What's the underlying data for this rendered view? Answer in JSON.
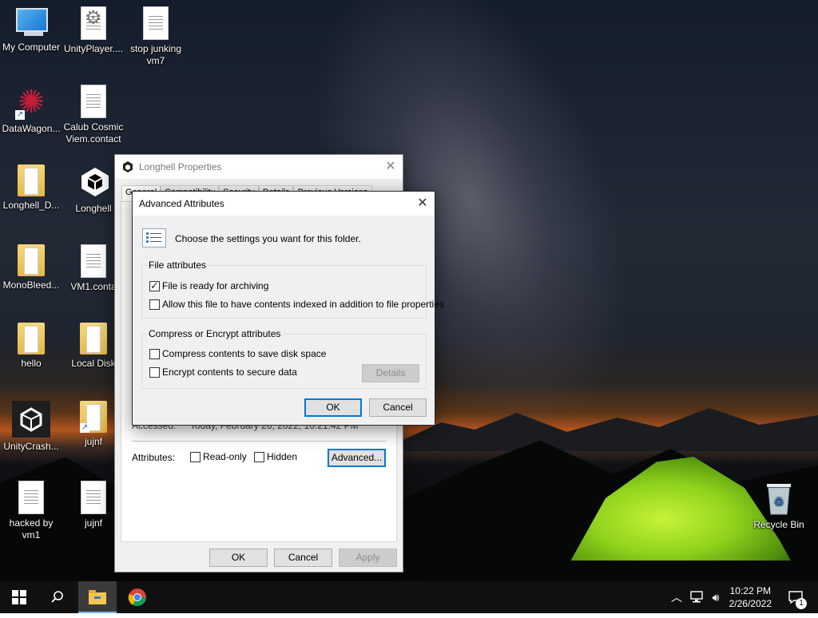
{
  "desktop_icons": [
    {
      "label": "My Computer"
    },
    {
      "label": "UnityPlayer...."
    },
    {
      "label": "stop junking vm7"
    },
    {
      "label": "DataWagon..."
    },
    {
      "label": "Calub Cosmic Viem.contact"
    },
    {
      "label": "Longhell_D..."
    },
    {
      "label": "Longhell"
    },
    {
      "label": "MonoBleed..."
    },
    {
      "label": "VM1.conta"
    },
    {
      "label": "hello"
    },
    {
      "label": "Local Disk"
    },
    {
      "label": "UnityCrash..."
    },
    {
      "label": "jujnf"
    },
    {
      "label": "hacked by vm1"
    },
    {
      "label": "jujnf"
    },
    {
      "label": "Recycle Bin"
    }
  ],
  "properties_window": {
    "title": "Longhell Properties",
    "tabs": [
      "General",
      "Compatibility",
      "Security",
      "Details",
      "Previous Versions"
    ],
    "accessed_label": "Accessed:",
    "accessed_value": "Today, February 26, 2022, 10:21:42 PM",
    "attributes_label": "Attributes:",
    "readonly_label": "Read-only",
    "hidden_label": "Hidden",
    "advanced_label": "Advanced...",
    "ok_label": "OK",
    "cancel_label": "Cancel",
    "apply_label": "Apply",
    "readonly_checked": false,
    "hidden_checked": false
  },
  "advanced_dialog": {
    "title": "Advanced Attributes",
    "intro": "Choose the settings you want for this folder.",
    "file_attributes_label": "File attributes",
    "archive_label": "File is ready for archiving",
    "archive_checked": true,
    "index_label": "Allow this file to have contents indexed in addition to file properties",
    "index_checked": false,
    "compress_group_label": "Compress or Encrypt attributes",
    "compress_label": "Compress contents to save disk space",
    "compress_checked": false,
    "encrypt_label": "Encrypt contents to secure data",
    "encrypt_checked": false,
    "details_label": "Details",
    "ok_label": "OK",
    "cancel_label": "Cancel"
  },
  "taskbar": {
    "time": "10:22 PM",
    "date": "2/26/2022",
    "notification_count": "1"
  },
  "colors": {
    "accent": "#0078d7",
    "taskbar": "#101010",
    "tent": "#9bd51f"
  }
}
